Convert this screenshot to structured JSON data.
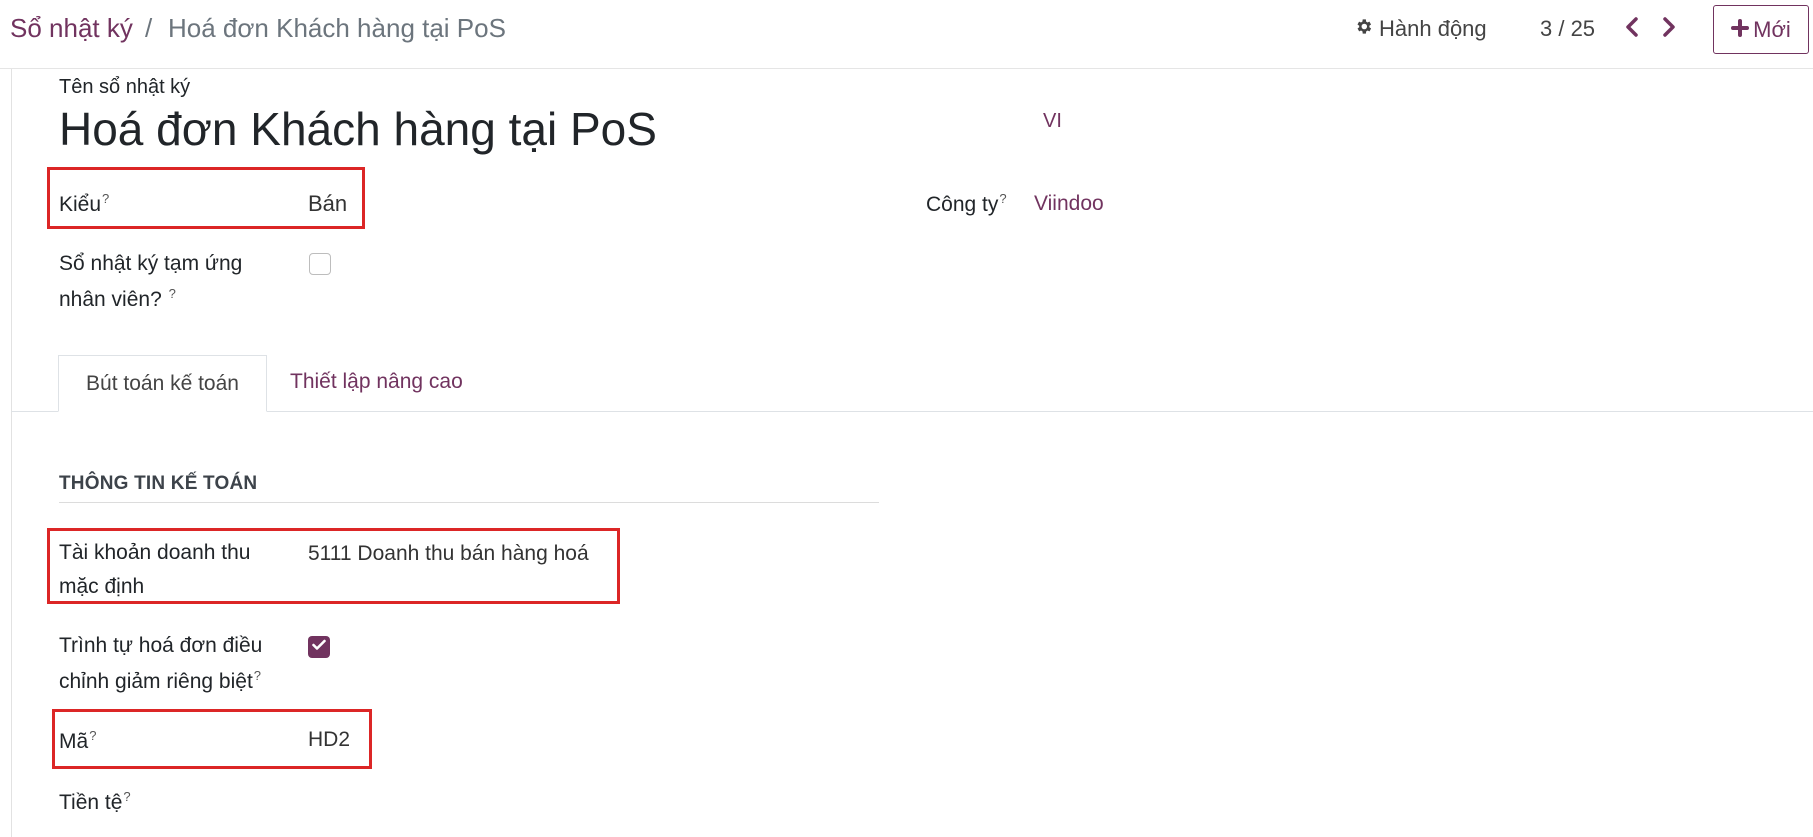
{
  "breadcrumb": {
    "root": "Sổ nhật ký",
    "separator": "/",
    "current": "Hoá đơn Khách hàng tại PoS"
  },
  "toolbar": {
    "actions_label": "Hành động",
    "actions_icon": "gear-icon",
    "pager": "3 / 25",
    "new_label": "Mới"
  },
  "form": {
    "name_label": "Tên sổ nhật ký",
    "name_value": "Hoá đơn Khách hàng tại PoS",
    "lang_badge": "VI",
    "type_label": "Kiểu",
    "type_help": "?",
    "type_value": "Bán",
    "company_label": "Công ty",
    "company_help": "?",
    "company_value": "Viindoo",
    "advance_label_line1": "Sổ nhật ký tạm ứng",
    "advance_label_line2": "nhân viên?",
    "advance_help": "?",
    "advance_checked": false
  },
  "tabs": {
    "active": "Bút toán kế toán",
    "inactive": "Thiết lập nâng cao"
  },
  "accounting": {
    "section_title": "THÔNG TIN KẾ TOÁN",
    "income_account_label_line1": "Tài khoản doanh thu",
    "income_account_label_line2": "mặc định",
    "income_account_value": "5111 Doanh thu bán hàng hoá",
    "refund_seq_label_line1": "Trình tự hoá đơn điều",
    "refund_seq_label_line2": "chỉnh giảm riêng biệt",
    "refund_seq_help": "?",
    "refund_seq_checked": true,
    "code_label": "Mã",
    "code_help": "?",
    "code_value": "HD2",
    "currency_label": "Tiền tệ",
    "currency_help": "?"
  },
  "colors": {
    "brand": "#71335f",
    "highlight_box": "#dc2626"
  }
}
